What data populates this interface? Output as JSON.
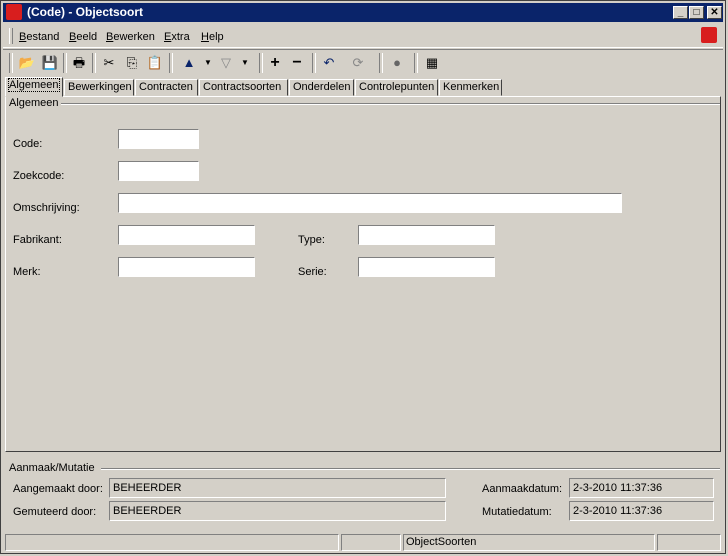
{
  "window": {
    "title": "(Code) - Objectsoort",
    "min": "_",
    "max": "□",
    "close": "✕"
  },
  "menu": [
    {
      "label": "Bestand",
      "ul": "B",
      "rest": "estand"
    },
    {
      "label": "Beeld",
      "ul": "B",
      "rest": "eeld"
    },
    {
      "label": "Bewerken",
      "ul": "B",
      "rest": "ewerken"
    },
    {
      "label": "Extra",
      "ul": "E",
      "rest": "xtra"
    },
    {
      "label": "Help",
      "ul": "H",
      "rest": "elp"
    }
  ],
  "tabs": [
    "Algemeen",
    "Bewerkingen",
    "Contracten",
    "Contractsoorten",
    "Onderdelen",
    "Controlepunten",
    "Kenmerken"
  ],
  "group_algemeen": "Algemeen",
  "fields": {
    "code": {
      "label": "Code:",
      "value": ""
    },
    "zoekcode": {
      "label": "Zoekcode:",
      "value": ""
    },
    "omschrijving": {
      "label": "Omschrijving:",
      "value": ""
    },
    "fabrikant": {
      "label": "Fabrikant:",
      "value": ""
    },
    "type": {
      "label": "Type:",
      "value": ""
    },
    "merk": {
      "label": "Merk:",
      "value": ""
    },
    "serie": {
      "label": "Serie:",
      "value": ""
    }
  },
  "mutatie": {
    "title": "Aanmaak/Mutatie",
    "aangemaakt_door_label": "Aangemaakt door:",
    "aangemaakt_door": "BEHEERDER",
    "gemuteerd_door_label": "Gemuteerd door:",
    "gemuteerd_door": "BEHEERDER",
    "aanmaakdatum_label": "Aanmaakdatum:",
    "aanmaakdatum": "2-3-2010 11:37:36",
    "mutatiedatum_label": "Mutatiedatum:",
    "mutatiedatum": "2-3-2010 11:37:36"
  },
  "status": {
    "center": "ObjectSoorten"
  }
}
